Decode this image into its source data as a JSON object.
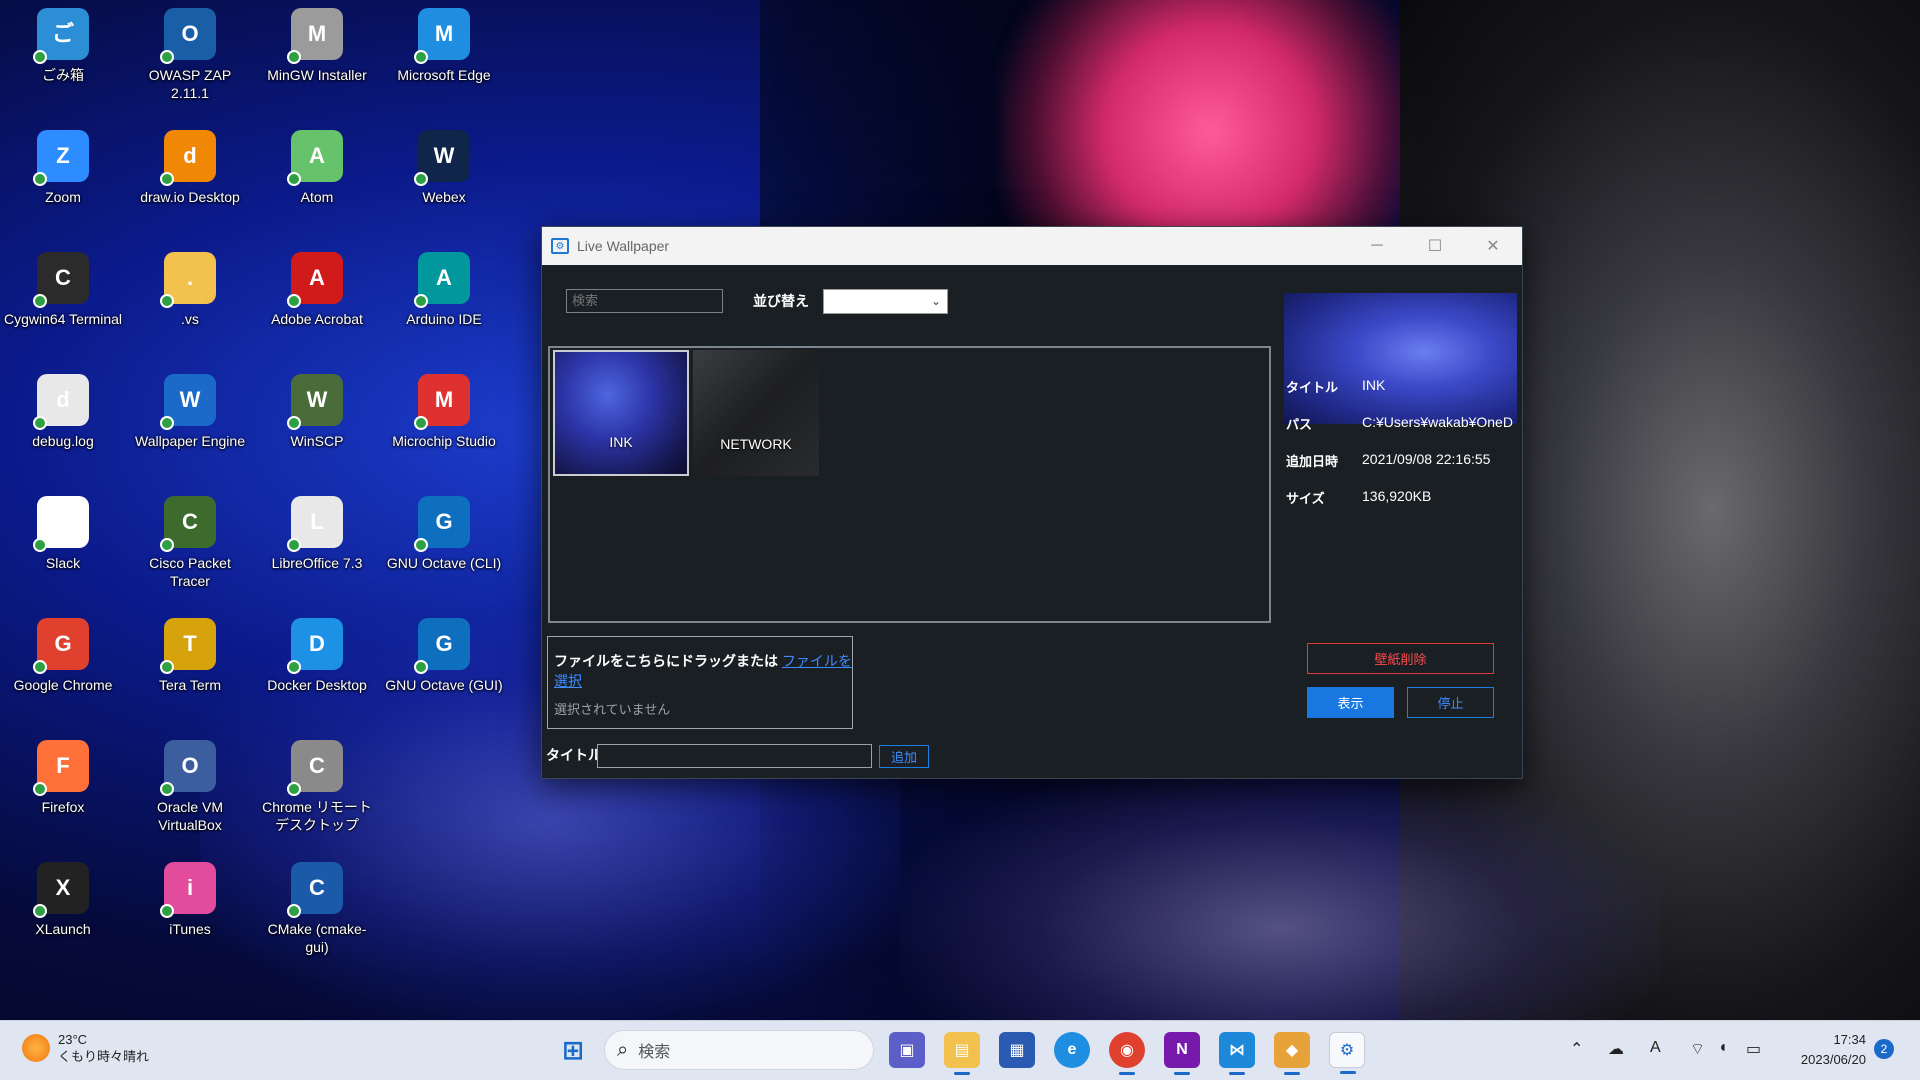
{
  "desktop": {
    "icons": [
      {
        "label": "ごみ箱",
        "color": "#2c8fd6"
      },
      {
        "label": "OWASP ZAP 2.11.1",
        "color": "#1b5ea8"
      },
      {
        "label": "MinGW Installer",
        "color": "#9b9b9b"
      },
      {
        "label": "Microsoft Edge",
        "color": "#1f8ee0"
      },
      {
        "label": "Zoom",
        "color": "#2d8cff"
      },
      {
        "label": "draw.io Desktop",
        "color": "#f08705"
      },
      {
        "label": "Atom",
        "color": "#66c26b"
      },
      {
        "label": "Webex",
        "color": "#10254a"
      },
      {
        "label": "Cygwin64 Terminal",
        "color": "#2b2b2b"
      },
      {
        "label": ".vs",
        "color": "#f2c14e"
      },
      {
        "label": "Adobe Acrobat",
        "color": "#d11b1b"
      },
      {
        "label": "Arduino IDE",
        "color": "#00979d"
      },
      {
        "label": "debug.log",
        "color": "#e8e8e8"
      },
      {
        "label": "Wallpaper Engine",
        "color": "#1b6ac9"
      },
      {
        "label": "WinSCP",
        "color": "#4a6b3a"
      },
      {
        "label": "Microchip Studio",
        "color": "#e03131"
      },
      {
        "label": "Slack",
        "color": "#ffffff"
      },
      {
        "label": "Cisco Packet Tracer",
        "color": "#3d6b2e"
      },
      {
        "label": "LibreOffice 7.3",
        "color": "#e8e8e8"
      },
      {
        "label": "GNU Octave (CLI)",
        "color": "#0e6fbf"
      },
      {
        "label": "Google Chrome",
        "color": "#e0412f"
      },
      {
        "label": "Tera Term",
        "color": "#d7a30c"
      },
      {
        "label": "Docker Desktop",
        "color": "#1d91e6"
      },
      {
        "label": "GNU Octave (GUI)",
        "color": "#0e6fbf"
      },
      {
        "label": "Firefox",
        "color": "#ff7139"
      },
      {
        "label": "Oracle VM VirtualBox",
        "color": "#3c5d9e"
      },
      {
        "label": "Chrome リモート デスクトップ",
        "color": "#8a8a8a"
      },
      {
        "label": "",
        "color": "#000000"
      },
      {
        "label": "XLaunch",
        "color": "#222222"
      },
      {
        "label": "iTunes",
        "color": "#e34c9c"
      },
      {
        "label": "CMake (cmake-gui)",
        "color": "#1b5aa8"
      }
    ]
  },
  "window": {
    "title": "Live Wallpaper",
    "search_placeholder": "検索",
    "sort_label": "並び替え",
    "sort_value": "",
    "thumbnails": [
      {
        "label": "INK"
      },
      {
        "label": "NETWORK"
      }
    ],
    "drop_text": "ファイルをこちらにドラッグまたは",
    "drop_link": "ファイルを選択",
    "drop_status": "選択されていません",
    "title_label": "タイトル",
    "title_value": "",
    "add_button": "追加",
    "details": {
      "title_label": "タイトル",
      "title_value": "INK",
      "path_label": "パス",
      "path_value": "C:¥Users¥wakab¥OneD",
      "added_label": "追加日時",
      "added_value": "2021/09/08 22:16:55",
      "size_label": "サイズ",
      "size_value": "136,920KB"
    },
    "delete_button": "壁紙削除",
    "show_button": "表示",
    "stop_button": "停止"
  },
  "taskbar": {
    "temperature": "23°C",
    "weather": "くもり時々晴れ",
    "search_placeholder": "検索",
    "time": "17:34",
    "date": "2023/06/20",
    "notification_count": "2"
  }
}
